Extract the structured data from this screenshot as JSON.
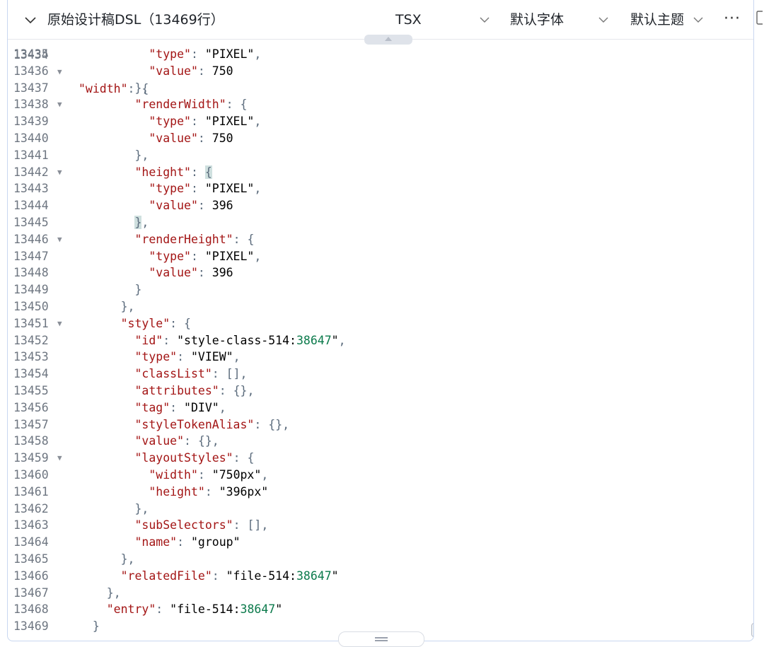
{
  "toolbar": {
    "title": "原始设计稿DSL（13469行）",
    "language": "TSX",
    "font": "默认字体",
    "theme": "默认主题",
    "more": "···"
  },
  "icons": {
    "title_toggle": "chevron-down-icon",
    "language_dropdown": "chevron-down-icon",
    "font_dropdown": "chevron-down-icon",
    "theme_dropdown": "chevron-down-icon",
    "more": "more-icon",
    "collapse": "triangle-up-icon",
    "resize": "drag-handle-icon"
  },
  "colors": {
    "key": "#a31515",
    "string": "#a31515",
    "number": "#0b7a4b",
    "punct": "#5b6b7c",
    "line_number": "#6e7681",
    "bracket_highlight": "#cfe0df"
  },
  "editor": {
    "partial_top_line": {
      "number": "13434",
      "text": "        \"width\": {"
    },
    "lines": [
      {
        "number": "13435",
        "text": "          \"type\": \"PIXEL\","
      },
      {
        "number": "13436",
        "text": "          \"value\": 750"
      },
      {
        "number": "13437",
        "text": "        },"
      },
      {
        "number": "13438",
        "text": "        \"renderWidth\": {",
        "fold": "▼"
      },
      {
        "number": "13439",
        "text": "          \"type\": \"PIXEL\","
      },
      {
        "number": "13440",
        "text": "          \"value\": 750"
      },
      {
        "number": "13441",
        "text": "        },"
      },
      {
        "number": "13442",
        "text": "        \"height\": {",
        "fold": "▼"
      },
      {
        "number": "13443",
        "text": "          \"type\": \"PIXEL\","
      },
      {
        "number": "13444",
        "text": "          \"value\": 396"
      },
      {
        "number": "13445",
        "text": "        },"
      },
      {
        "number": "13446",
        "text": "        \"renderHeight\": {",
        "fold": "▼"
      },
      {
        "number": "13447",
        "text": "          \"type\": \"PIXEL\","
      },
      {
        "number": "13448",
        "text": "          \"value\": 396"
      },
      {
        "number": "13449",
        "text": "        }"
      },
      {
        "number": "13450",
        "text": "      },"
      },
      {
        "number": "13451",
        "text": "      \"style\": {",
        "fold": "▼"
      },
      {
        "number": "13452",
        "text": "        \"id\": \"style-class-514:38647\","
      },
      {
        "number": "13453",
        "text": "        \"type\": \"VIEW\","
      },
      {
        "number": "13454",
        "text": "        \"classList\": [],"
      },
      {
        "number": "13455",
        "text": "        \"attributes\": {},"
      },
      {
        "number": "13456",
        "text": "        \"tag\": \"DIV\","
      },
      {
        "number": "13457",
        "text": "        \"styleTokenAlias\": {},"
      },
      {
        "number": "13458",
        "text": "        \"value\": {},"
      },
      {
        "number": "13459",
        "text": "        \"layoutStyles\": {",
        "fold": "▼"
      },
      {
        "number": "13460",
        "text": "          \"width\": \"750px\","
      },
      {
        "number": "13461",
        "text": "          \"height\": \"396px\""
      },
      {
        "number": "13462",
        "text": "        },"
      },
      {
        "number": "13463",
        "text": "        \"subSelectors\": [],"
      },
      {
        "number": "13464",
        "text": "        \"name\": \"group\""
      },
      {
        "number": "13465",
        "text": "      },"
      },
      {
        "number": "13466",
        "text": "      \"relatedFile\": \"file-514:38647\""
      },
      {
        "number": "13467",
        "text": "    },"
      },
      {
        "number": "13468",
        "text": "    \"entry\": \"file-514:38647\""
      },
      {
        "number": "13469",
        "text": "  }"
      }
    ]
  }
}
